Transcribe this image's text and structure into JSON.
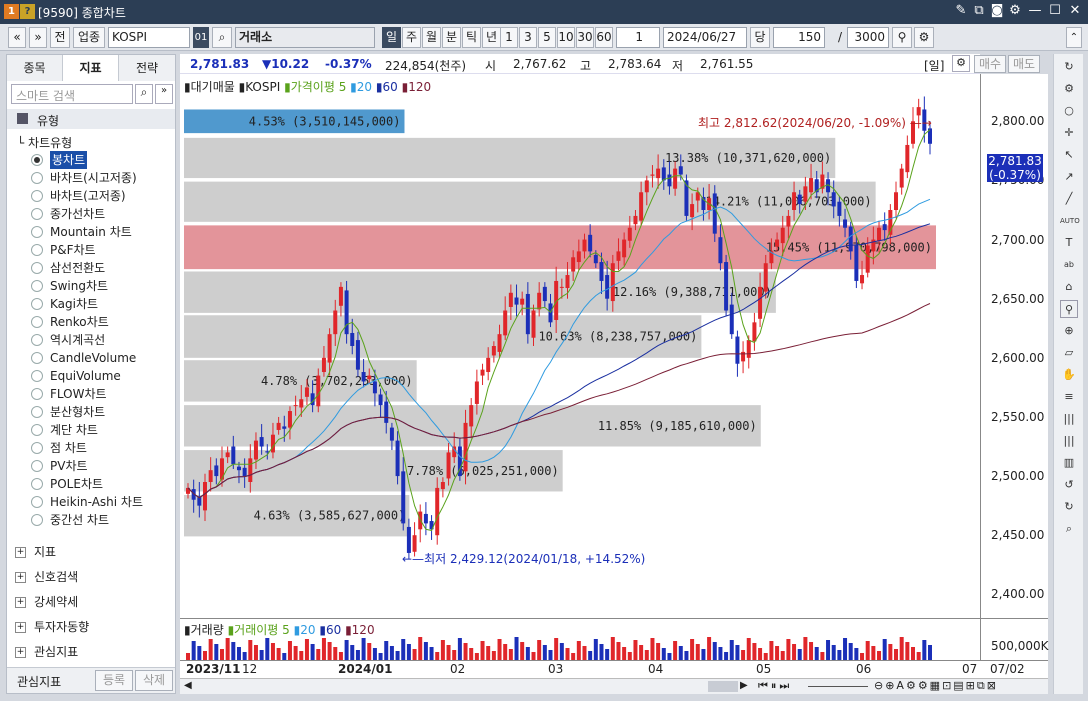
{
  "window": {
    "title": "[9590] 종합차트",
    "badge1": "1",
    "badge2": "?"
  },
  "toolbar": {
    "market_type": "업종",
    "code": "KOSPI",
    "exchange": "거래소",
    "periods": [
      "일",
      "주",
      "월",
      "분",
      "틱",
      "년"
    ],
    "nums": [
      "1",
      "3",
      "5",
      "10",
      "30",
      "60"
    ],
    "count": "1",
    "date": "2024/06/27",
    "unit": "당",
    "bars": "150",
    "total": "3000",
    "nav": [
      "«",
      "»",
      "전"
    ],
    "id": "01"
  },
  "left": {
    "tabs": [
      "종목",
      "지표",
      "전략"
    ],
    "search_placeholder": "스마트 검색",
    "section": "유형",
    "subsection": "차트유형",
    "chart_types": [
      "봉차트",
      "바차트(시고저종)",
      "바차트(고저종)",
      "종가선차트",
      "Mountain 차트",
      "P&F차트",
      "삼선전환도",
      "Swing차트",
      "Kagi차트",
      "Renko차트",
      "역시계곡선",
      "CandleVolume",
      "EquiVolume",
      "FLOW차트",
      "분산형차트",
      "계단 차트",
      "점 차트",
      "PV차트",
      "POLE차트",
      "Heikin-Ashi 차트",
      "중간선 차트"
    ],
    "groups": [
      "지표",
      "신호검색",
      "강세약세",
      "투자자동향",
      "관심지표"
    ],
    "bottom_label": "관심지표",
    "btn_register": "등록",
    "btn_delete": "삭제"
  },
  "info": {
    "price": "2,781.83",
    "change": "▼10.22",
    "pct": "-0.37%",
    "volume": "224,854(천주)",
    "open_l": "시",
    "open": "2,767.62",
    "high_l": "고",
    "high": "2,783.64",
    "low_l": "저",
    "low": "2,761.55",
    "period": "[일]",
    "buy": "매수",
    "sell": "매도"
  },
  "legend": {
    "a": "대기매물",
    "b": "KOSPI",
    "c": "가격이평 5",
    "d": "20",
    "e": "60",
    "f": "120"
  },
  "vol_legend": {
    "a": "거래량",
    "b": "거래이평 5",
    "c": "20",
    "d": "60",
    "e": "120"
  },
  "annot": {
    "high": "최고 2,812.62(2024/06/20, -1.09%)",
    "low": "최저 2,429.12(2024/01/18, +14.52%)"
  },
  "price_tag": {
    "price": "2,781.83",
    "pct": "(-0.37%)"
  },
  "y_labels": [
    "2,800.00",
    "2,750.00",
    "2,700.00",
    "2,650.00",
    "2,600.00",
    "2,550.00",
    "2,500.00",
    "2,450.00",
    "2,400.00"
  ],
  "vol_label": "500,000K",
  "x_labels": [
    "2023/11",
    "12",
    "2024/01",
    "02",
    "03",
    "04",
    "05",
    "06",
    "07",
    "07/02"
  ],
  "colors": {
    "up": "#e0262a",
    "down": "#1b2fb8",
    "ma5": "#5aa21b",
    "ma20": "#2f9be0",
    "ma60": "#1a2fa0",
    "ma120": "#7a1f36",
    "band": "#c9c9c9",
    "band_hi": "#e0888f",
    "band_blue": "#3d8ec9"
  },
  "chart_data": {
    "type": "candlestick",
    "ylim": [
      2380,
      2840
    ],
    "bands": [
      {
        "label": "4.53% (3,510,145,000)",
        "lo": 2790,
        "hi": 2810,
        "hl": "blue"
      },
      {
        "label": "13.38% (10,371,620,000)",
        "lo": 2752,
        "hi": 2786,
        "hl": ""
      },
      {
        "label": "14.21% (11,006,703,000)",
        "lo": 2715,
        "hi": 2749,
        "hl": ""
      },
      {
        "label": "15.45% (11,970,798,000)",
        "lo": 2675,
        "hi": 2712,
        "hl": "red"
      },
      {
        "label": "12.16% (9,388,711,000)",
        "lo": 2638,
        "hi": 2673,
        "hl": ""
      },
      {
        "label": "10.63% (8,238,757,000)",
        "lo": 2600,
        "hi": 2636,
        "hl": ""
      },
      {
        "label": "4.78% (3,702,253,000)",
        "lo": 2563,
        "hi": 2598,
        "hl": ""
      },
      {
        "label": "11.85% (9,185,610,000)",
        "lo": 2525,
        "hi": 2560,
        "hl": ""
      },
      {
        "label": "7.78% (6,025,251,000)",
        "lo": 2487,
        "hi": 2522,
        "hl": ""
      },
      {
        "label": "4.63% (3,585,627,000)",
        "lo": 2449,
        "hi": 2484,
        "hl": ""
      }
    ],
    "close": [
      2490,
      2480,
      2475,
      2495,
      2505,
      2500,
      2515,
      2520,
      2510,
      2505,
      2500,
      2515,
      2530,
      2525,
      2520,
      2535,
      2545,
      2540,
      2555,
      2560,
      2565,
      2575,
      2560,
      2585,
      2600,
      2620,
      2640,
      2660,
      2620,
      2610,
      2590,
      2580,
      2585,
      2570,
      2560,
      2545,
      2530,
      2500,
      2460,
      2435,
      2450,
      2470,
      2460,
      2455,
      2490,
      2495,
      2520,
      2525,
      2500,
      2545,
      2560,
      2580,
      2590,
      2600,
      2610,
      2620,
      2640,
      2655,
      2645,
      2650,
      2620,
      2640,
      2655,
      2648,
      2630,
      2665,
      2660,
      2670,
      2685,
      2690,
      2700,
      2690,
      2680,
      2665,
      2650,
      2680,
      2690,
      2700,
      2710,
      2720,
      2740,
      2750,
      2755,
      2760,
      2750,
      2745,
      2760,
      2755,
      2720,
      2730,
      2740,
      2725,
      2735,
      2705,
      2680,
      2640,
      2620,
      2595,
      2605,
      2615,
      2630,
      2660,
      2680,
      2690,
      2700,
      2710,
      2720,
      2740,
      2730,
      2745,
      2752,
      2740,
      2755,
      2740,
      2728,
      2720,
      2710,
      2690,
      2665,
      2670,
      2695,
      2700,
      2710,
      2708,
      2725,
      2740,
      2760,
      2780,
      2800,
      2812,
      2792,
      2781
    ]
  }
}
